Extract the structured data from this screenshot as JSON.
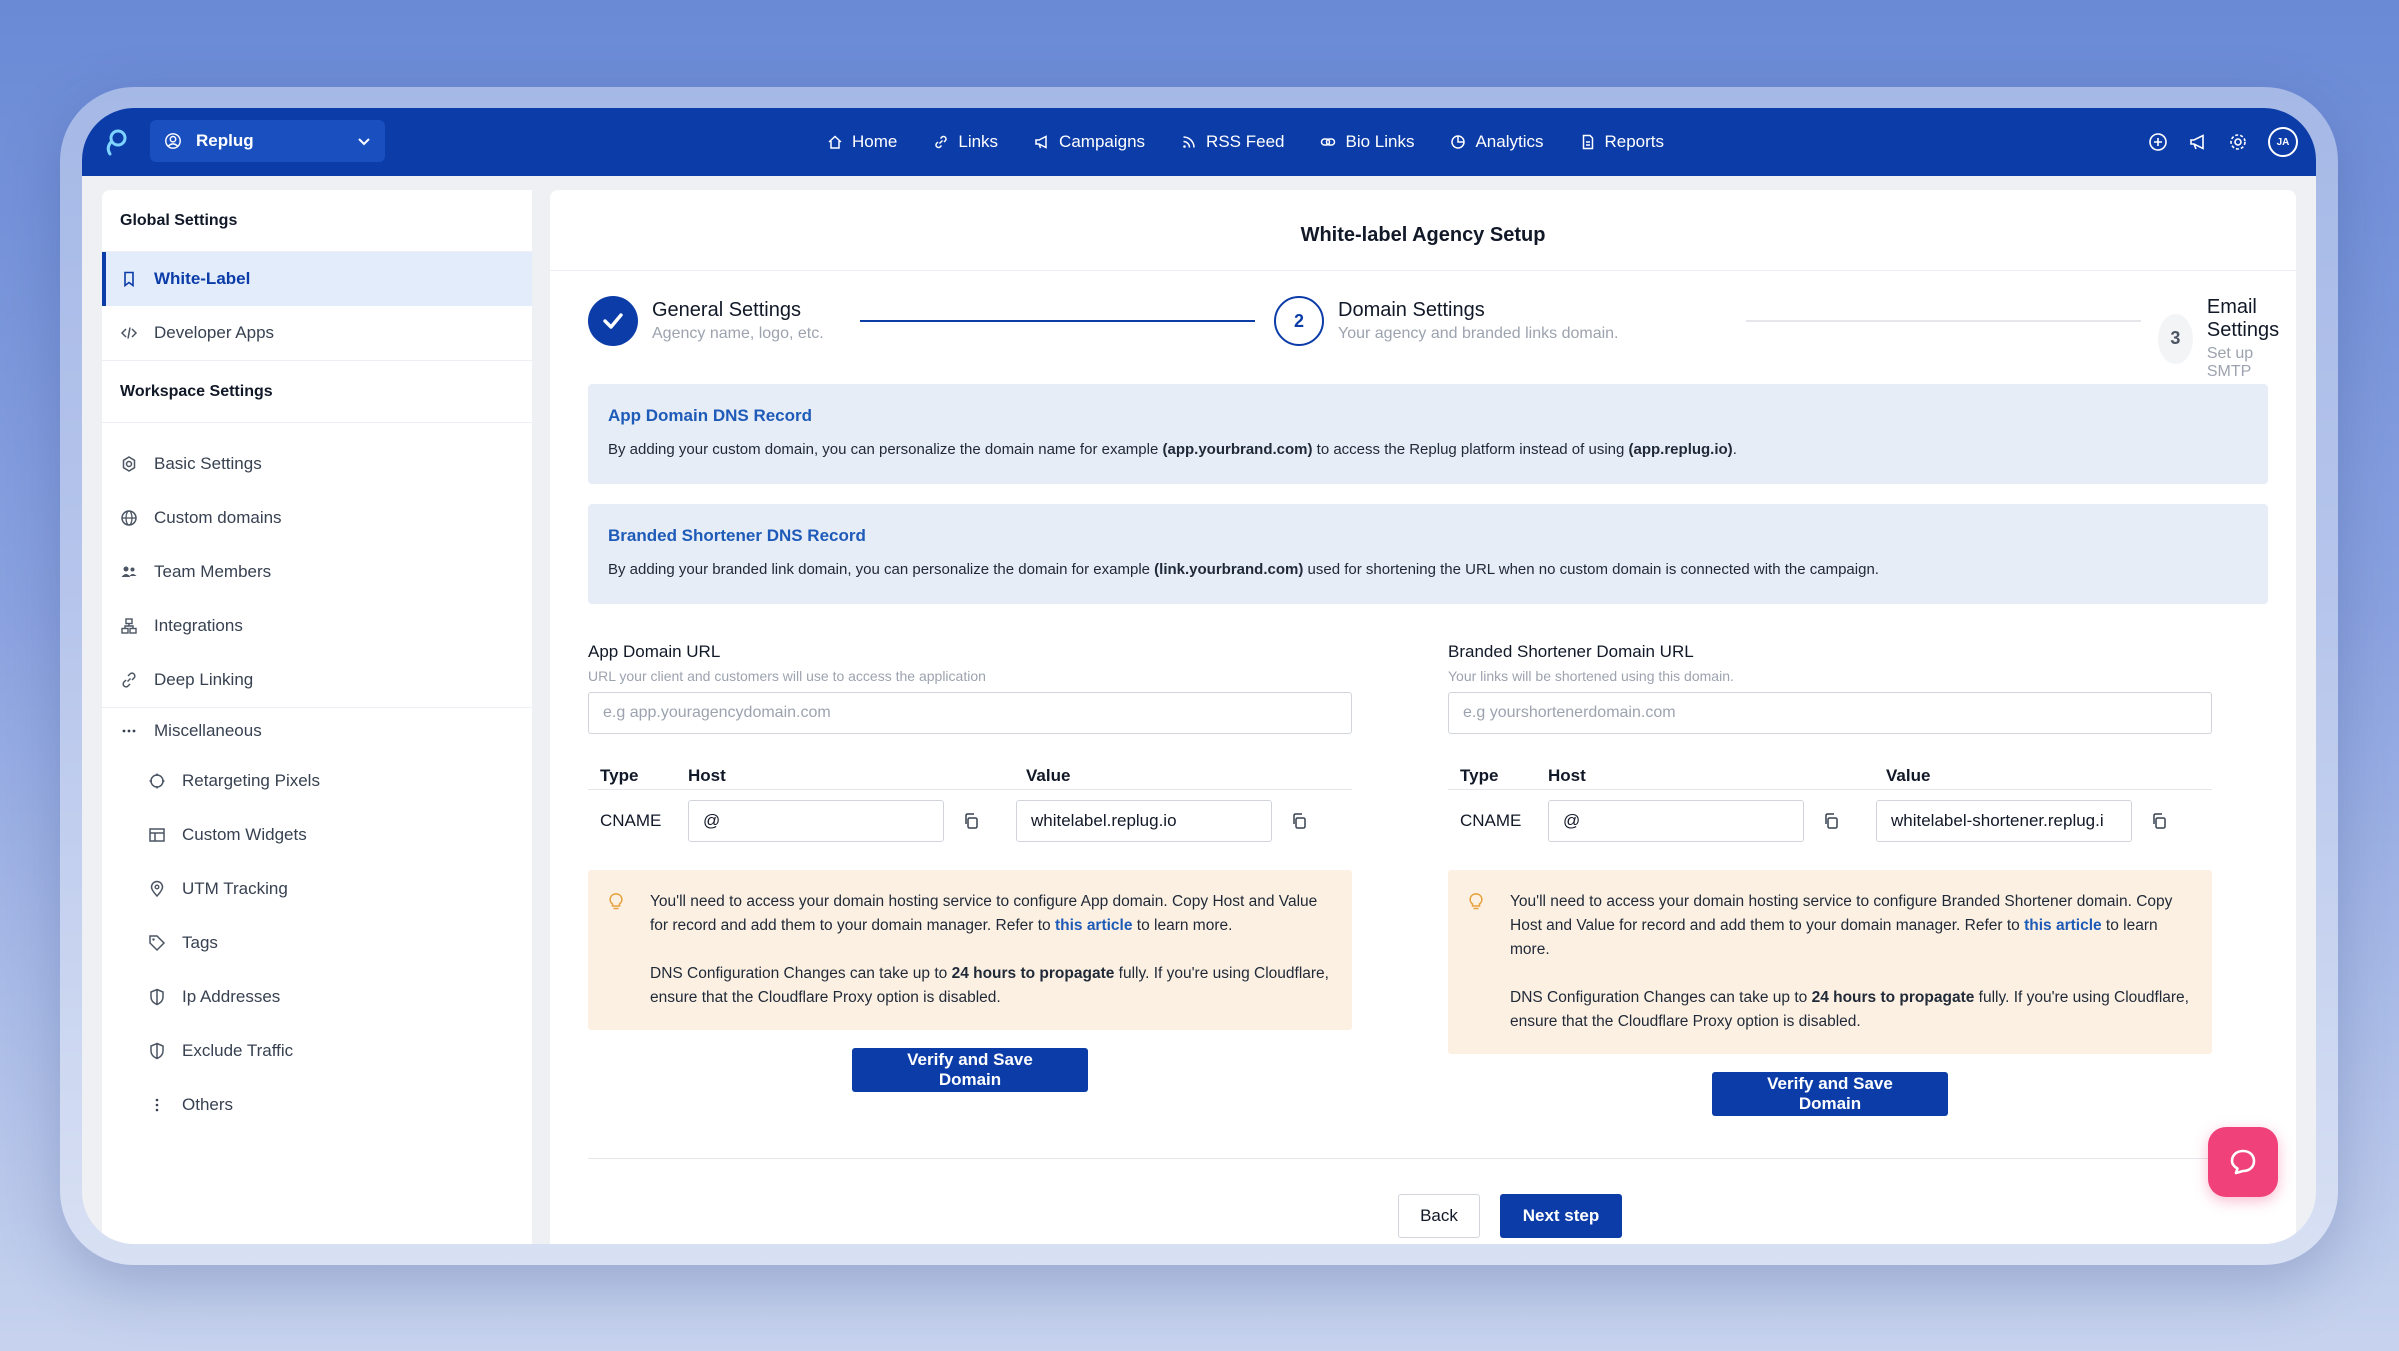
{
  "topbar": {
    "workspace": "Replug",
    "nav": [
      {
        "label": "Home",
        "icon": "home-icon"
      },
      {
        "label": "Links",
        "icon": "link-icon"
      },
      {
        "label": "Campaigns",
        "icon": "megaphone-icon"
      },
      {
        "label": "RSS Feed",
        "icon": "rss-icon"
      },
      {
        "label": "Bio Links",
        "icon": "bio-link-icon"
      },
      {
        "label": "Analytics",
        "icon": "analytics-icon"
      },
      {
        "label": "Reports",
        "icon": "report-icon"
      }
    ],
    "avatar_initials": "JA"
  },
  "sidebar": {
    "global_heading": "Global Settings",
    "global_items": [
      {
        "label": "White-Label",
        "active": true
      },
      {
        "label": "Developer Apps"
      }
    ],
    "workspace_heading": "Workspace Settings",
    "workspace_items": [
      {
        "label": "Basic Settings"
      },
      {
        "label": "Custom domains"
      },
      {
        "label": "Team Members"
      },
      {
        "label": "Integrations"
      },
      {
        "label": "Deep Linking"
      },
      {
        "label": "Miscellaneous"
      }
    ],
    "misc_items": [
      {
        "label": "Retargeting Pixels"
      },
      {
        "label": "Custom Widgets"
      },
      {
        "label": "UTM Tracking"
      },
      {
        "label": "Tags"
      },
      {
        "label": "Ip Addresses"
      },
      {
        "label": "Exclude Traffic"
      },
      {
        "label": "Others"
      }
    ]
  },
  "main": {
    "title": "White-label Agency Setup",
    "steps": [
      {
        "title": "General Settings",
        "subtitle": "Agency name, logo, etc.",
        "state": "done"
      },
      {
        "number": "2",
        "title": "Domain Settings",
        "subtitle": "Your agency and branded links domain.",
        "state": "current"
      },
      {
        "number": "3",
        "title": "Email Settings",
        "subtitle": "Set up SMTP",
        "state": "upcoming"
      }
    ],
    "app_dns": {
      "title": "App Domain DNS Record",
      "text_before": "By adding your custom domain, you can personalize the domain name for example ",
      "bold1": "(app.yourbrand.com)",
      "text_middle": " to access the Replug platform instead of using ",
      "bold2": "(app.replug.io)",
      "text_after": "."
    },
    "branded_dns": {
      "title": "Branded Shortener DNS Record",
      "text_before": "By adding your branded link domain, you can personalize the domain for example ",
      "bold1": "(link.yourbrand.com)",
      "text_after": " used for shortening the URL when no custom domain is connected with the campaign."
    },
    "app_domain": {
      "label": "App Domain URL",
      "sublabel": "URL your client and customers will use to access the application",
      "placeholder": "e.g app.youragencydomain.com",
      "col_type": "Type",
      "col_host": "Host",
      "col_value": "Value",
      "type": "CNAME",
      "host": "@",
      "value": "whitelabel.replug.io",
      "warn1_before": "You'll need to access your domain hosting service to configure App domain. Copy Host and Value for record and add them to your domain manager. Refer to ",
      "warn_link": "this article",
      "warn1_after": " to learn more.",
      "warn2_before": "DNS Configuration Changes can take up to ",
      "warn2_bold": "24 hours to propagate",
      "warn2_after": " fully. If you're using Cloudflare, ensure that the Cloudflare Proxy option is disabled.",
      "button": "Verify and Save Domain"
    },
    "branded_domain": {
      "label": "Branded Shortener Domain URL",
      "sublabel": "Your links will be shortened using this domain.",
      "placeholder": "e.g yourshortenerdomain.com",
      "col_type": "Type",
      "col_host": "Host",
      "col_value": "Value",
      "type": "CNAME",
      "host": "@",
      "value": "whitelabel-shortener.replug.i",
      "warn1_before": "You'll need to access your domain hosting service to configure Branded Shortener domain. Copy Host and Value for record and add them to your domain manager. Refer to ",
      "warn_link": "this article",
      "warn1_after": " to learn more.",
      "warn2_before": "DNS Configuration Changes can take up to ",
      "warn2_bold": "24 hours to propagate",
      "warn2_after": " fully. If you're using Cloudflare, ensure that the Cloudflare Proxy option is disabled.",
      "button": "Verify and Save Domain"
    },
    "back_button": "Back",
    "next_button": "Next step"
  },
  "colors": {
    "primary": "#0b3ca8",
    "accent_link": "#1e5bb8",
    "warning_bg": "#fcf0e3",
    "chat_button": "#f0417a"
  }
}
